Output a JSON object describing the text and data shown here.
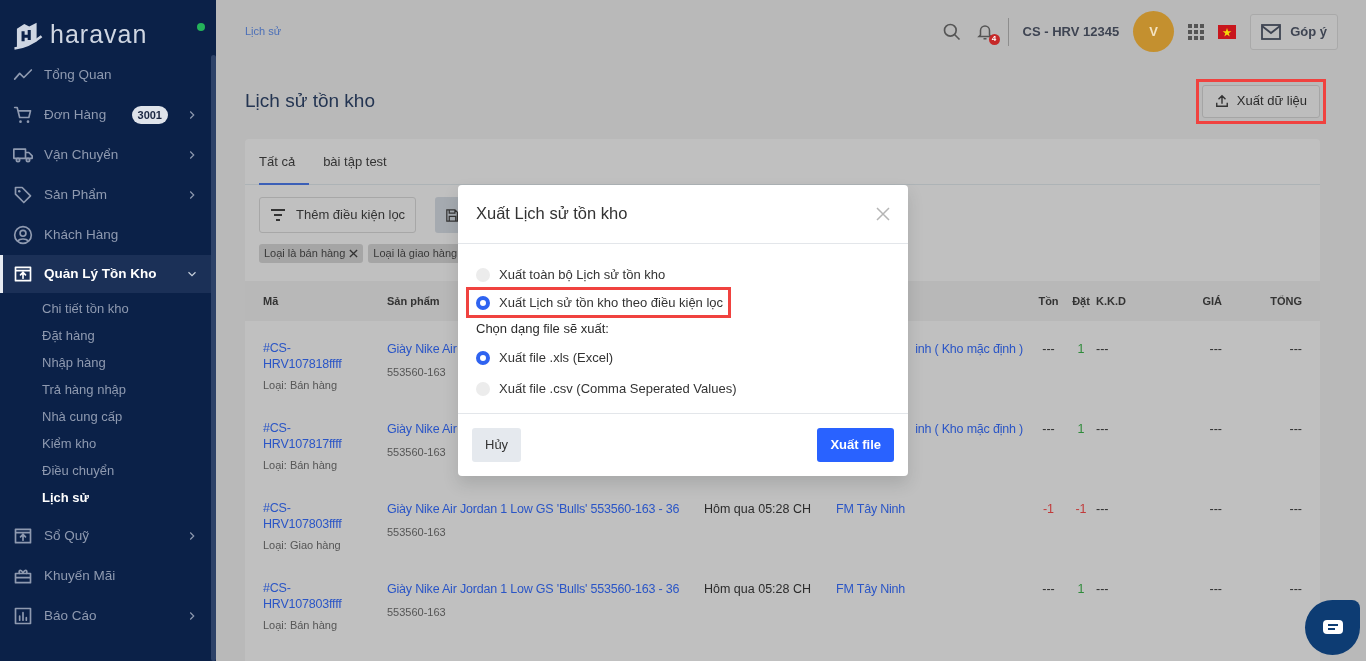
{
  "sidebar": {
    "brand": "haravan",
    "online": true,
    "items": [
      {
        "label": "Tổng Quan",
        "selected": false
      },
      {
        "label": "Đơn Hàng",
        "badge": "3001",
        "expanded": false,
        "selected": false
      },
      {
        "label": "Vận Chuyển",
        "expanded": false,
        "selected": false
      },
      {
        "label": "Sản Phẩm",
        "expanded": false,
        "selected": false
      },
      {
        "label": "Khách Hàng",
        "selected": false
      },
      {
        "label": "Quản Lý Tồn Kho",
        "expanded": true,
        "selected": true,
        "children": [
          {
            "label": "Chi tiết tồn kho",
            "selected": false
          },
          {
            "label": "Đặt hàng",
            "selected": false
          },
          {
            "label": "Nhập hàng",
            "selected": false
          },
          {
            "label": "Trả hàng nhập",
            "selected": false
          },
          {
            "label": "Nhà cung cấp",
            "selected": false
          },
          {
            "label": "Kiểm kho",
            "selected": false
          },
          {
            "label": "Điều chuyển",
            "selected": false
          },
          {
            "label": "Lịch sử",
            "selected": true
          }
        ]
      },
      {
        "label": "Sổ Quỹ",
        "expanded": false,
        "selected": false
      },
      {
        "label": "Khuyến Mãi",
        "selected": false
      },
      {
        "label": "Báo Cáo",
        "expanded": false,
        "selected": false
      }
    ]
  },
  "topbar": {
    "breadcrumb": "Lịch sử",
    "notifications": "4",
    "store": "CS - HRV 12345",
    "avatar": "V",
    "feedback": "Góp ý"
  },
  "page": {
    "title": "Lịch sử tồn kho",
    "export_button": {
      "label": "Xuất dữ liệu",
      "highlighted": true
    }
  },
  "tabs": [
    {
      "label": "Tất cả",
      "selected": true
    },
    {
      "label": "bài tập test",
      "selected": false
    }
  ],
  "filter_button": "Thêm điều kiện lọc",
  "chips": [
    "Loại là bán hàng",
    "Loại là giao hàng"
  ],
  "table": {
    "columns": [
      "Mã",
      "Sản phẩm",
      "Tồn",
      "Đặt",
      "K.K.D",
      "GIÁ",
      "TỔNG"
    ],
    "rows": [
      {
        "code": "#CS-HRV107818ffff",
        "type": "Loại: Bán hàng",
        "product": "Giày Nike Air",
        "sku": "553560-163",
        "location": "inh ( Kho mặc định )",
        "stock": "---",
        "ordered": "1",
        "kkd": "---",
        "price": "---",
        "total": "---"
      },
      {
        "code": "#CS-HRV107817ffff",
        "type": "Loại: Bán hàng",
        "product": "Giày Nike Air",
        "sku": "553560-163",
        "location": "inh ( Kho mặc định )",
        "stock": "---",
        "ordered": "1",
        "kkd": "---",
        "price": "---",
        "total": "---"
      },
      {
        "code": "#CS-HRV107803ffff",
        "type": "Loại: Giao hàng",
        "product": "Giày Nike Air Jordan 1 Low GS 'Bulls' 553560-163 - 36",
        "sku": "553560-163",
        "time": "Hôm qua 05:28 CH",
        "location": "FM Tây Ninh",
        "stock": "-1",
        "ordered": "-1",
        "kkd": "---",
        "price": "---",
        "total": "---"
      },
      {
        "code": "#CS-HRV107803ffff",
        "type": "Loại: Bán hàng",
        "product": "Giày Nike Air Jordan 1 Low GS 'Bulls' 553560-163 - 36",
        "sku": "553560-163",
        "time": "Hôm qua 05:28 CH",
        "location": "FM Tây Ninh",
        "stock": "---",
        "ordered": "1",
        "kkd": "---",
        "price": "---",
        "total": "---"
      }
    ]
  },
  "modal": {
    "title": "Xuất Lịch sử tồn kho",
    "scope_options": [
      {
        "label": "Xuất toàn bộ Lịch sử tồn kho",
        "selected": false
      },
      {
        "label": "Xuất Lịch sử tồn kho theo điều kiện lọc",
        "selected": true,
        "highlighted": true
      }
    ],
    "format_label": "Chọn dạng file sẽ xuất:",
    "format_options": [
      {
        "label": "Xuất file .xls (Excel)",
        "selected": true
      },
      {
        "label": "Xuất file .csv (Comma Seperated Values)",
        "selected": false
      }
    ],
    "cancel": "Hủy",
    "confirm": "Xuất file"
  }
}
